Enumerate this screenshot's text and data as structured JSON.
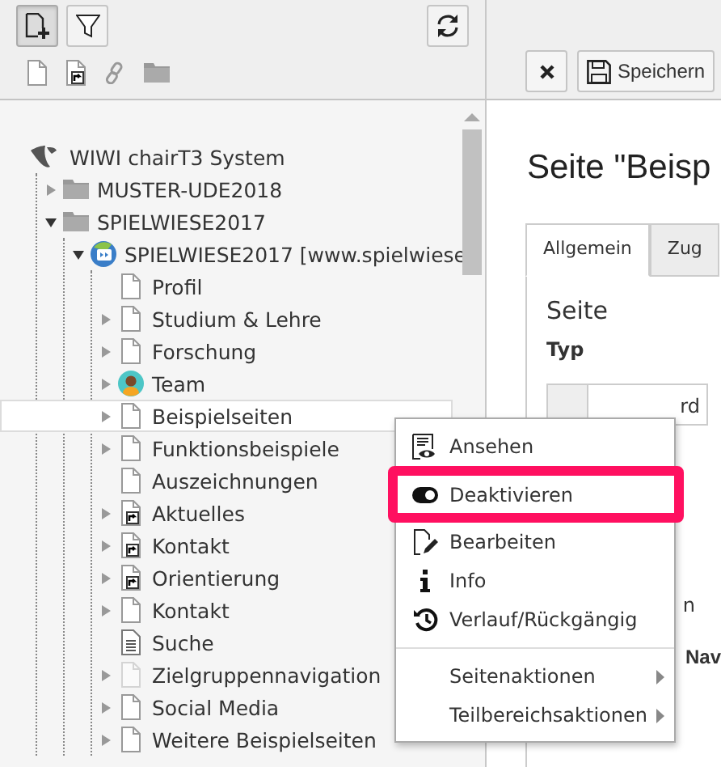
{
  "tree_toolbar": {
    "buttons": [
      {
        "kind": "new",
        "selected": true
      },
      {
        "kind": "filter",
        "selected": false
      },
      {
        "kind": "refresh",
        "selected": false
      }
    ]
  },
  "page_tree": {
    "root": {
      "label": "WIWI chairT3 System",
      "children": [
        {
          "label": "MUSTER-UDE2018",
          "kind": "folder",
          "expanded": false,
          "selected": false
        },
        {
          "label": "SPIELWIESE2017",
          "kind": "folder",
          "expanded": true,
          "selected": false,
          "children": [
            {
              "label": "SPIELWIESE2017 [www.spielwiese",
              "kind": "site",
              "expanded": true,
              "selected": false,
              "children": [
                {
                  "label": "Profil",
                  "kind": "page",
                  "selected": false
                },
                {
                  "label": "Studium & Lehre",
                  "kind": "page",
                  "expanded": false,
                  "selected": false
                },
                {
                  "label": "Forschung",
                  "kind": "page",
                  "expanded": false,
                  "selected": false
                },
                {
                  "label": "Team",
                  "kind": "user",
                  "expanded": false,
                  "selected": false
                },
                {
                  "label": "Beispielseiten",
                  "kind": "page",
                  "expanded": false,
                  "selected": true
                },
                {
                  "label": "Funktionsbeispiele",
                  "kind": "page",
                  "expanded": false,
                  "selected": false
                },
                {
                  "label": "Auszeichnungen",
                  "kind": "page",
                  "selected": false
                },
                {
                  "label": "Aktuelles",
                  "kind": "shortcut",
                  "expanded": false,
                  "selected": false
                },
                {
                  "label": "Kontakt",
                  "kind": "shortcut",
                  "expanded": false,
                  "selected": false
                },
                {
                  "label": "Orientierung",
                  "kind": "shortcut",
                  "expanded": false,
                  "selected": false
                },
                {
                  "label": "Kontakt",
                  "kind": "page",
                  "expanded": false,
                  "selected": false
                },
                {
                  "label": "Suche",
                  "kind": "search",
                  "selected": false
                },
                {
                  "label": "Zielgruppennavigation",
                  "kind": "hidden",
                  "expanded": false,
                  "selected": false
                },
                {
                  "label": "Social Media",
                  "kind": "page",
                  "expanded": false,
                  "selected": false
                },
                {
                  "label": "Weitere Beispielseiten",
                  "kind": "page",
                  "expanded": false,
                  "selected": false
                }
              ]
            }
          ]
        }
      ]
    }
  },
  "editor_toolbar": {
    "save_label": "Speichern"
  },
  "editor": {
    "title": "Seite \"Beisp",
    "tabs": [
      {
        "label": "Allgemein",
        "selected": true
      },
      {
        "label": "Zug",
        "selected": false
      }
    ],
    "section": "Seite",
    "field_label": "Typ",
    "field_value_tail": "rd",
    "partial_tab": "n",
    "partial_label": "Nav"
  },
  "context_menu": {
    "items": [
      {
        "label": "Ansehen",
        "kind": "view",
        "highlighted": false
      },
      {
        "label": "Deaktivieren",
        "kind": "toggle",
        "highlighted": true
      },
      {
        "label": "Bearbeiten",
        "kind": "edit",
        "highlighted": false
      },
      {
        "label": "Info",
        "kind": "info",
        "highlighted": false
      },
      {
        "label": "Verlauf/Rückgängig",
        "kind": "history",
        "highlighted": false
      },
      {
        "label": "Seitenaktionen",
        "kind": "submenu",
        "highlighted": false
      },
      {
        "label": "Teilbereichsaktionen",
        "kind": "submenu",
        "highlighted": false
      }
    ]
  }
}
